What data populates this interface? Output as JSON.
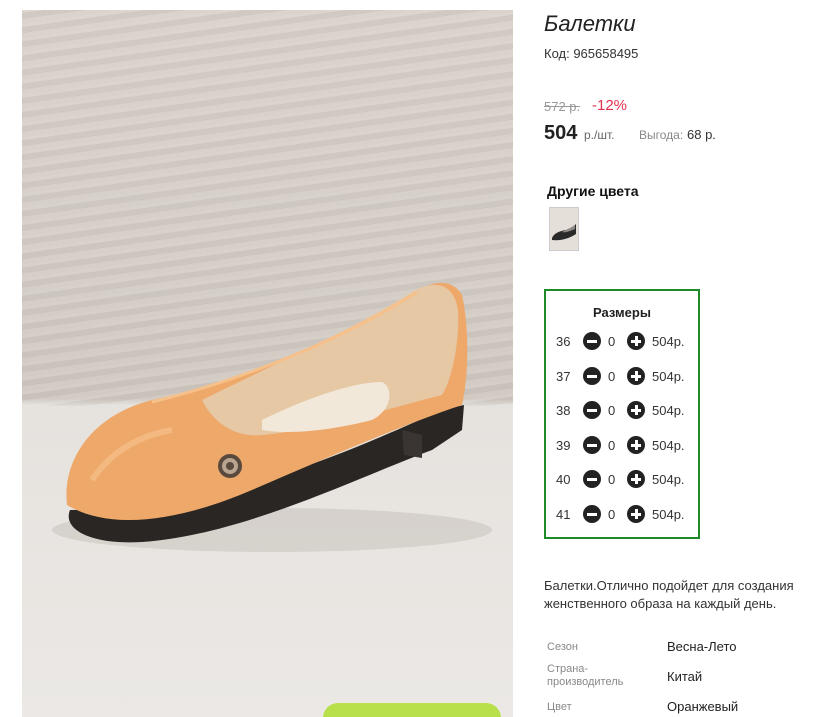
{
  "product": {
    "title": "Балетки",
    "code": "Код: 965658495",
    "old_price": "572 р.",
    "discount": "-12%",
    "price": "504",
    "price_unit": "р./шт.",
    "savings_label": "Выгода:",
    "savings_value": "68 р."
  },
  "other_colors": {
    "heading": "Другие цвета"
  },
  "sizes": {
    "heading": "Размеры",
    "rows": [
      {
        "size": "36",
        "qty": "0",
        "price": "504р."
      },
      {
        "size": "37",
        "qty": "0",
        "price": "504р."
      },
      {
        "size": "38",
        "qty": "0",
        "price": "504р."
      },
      {
        "size": "39",
        "qty": "0",
        "price": "504р."
      },
      {
        "size": "40",
        "qty": "0",
        "price": "504р."
      },
      {
        "size": "41",
        "qty": "0",
        "price": "504р."
      }
    ]
  },
  "description": "Балетки.Отлично подойдет для создания женственного образа на каждый день.",
  "specs": [
    {
      "label": "Сезон",
      "value": "Весна-Лето"
    },
    {
      "label": "Страна-производитель",
      "value": "Китай"
    },
    {
      "label": "Цвет",
      "value": "Оранжевый"
    }
  ],
  "colors": {
    "accent_green": "#1e8a2a",
    "discount_red": "#e0314f",
    "cart_button": "#b8e04a"
  }
}
